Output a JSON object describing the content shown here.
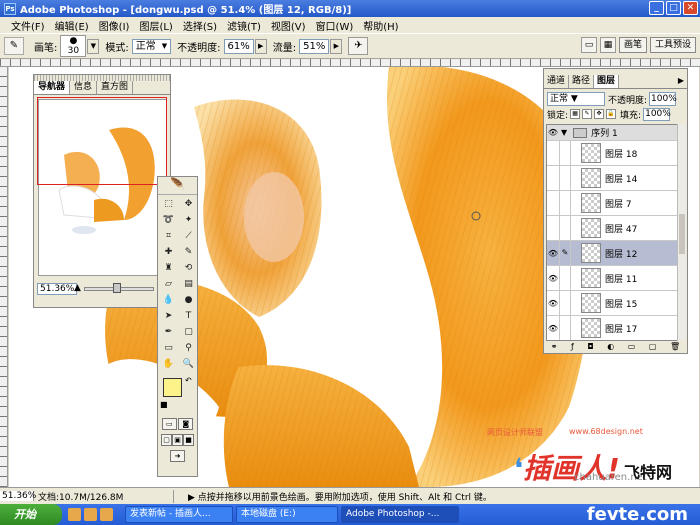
{
  "window": {
    "app_name": "Adobe Photoshop",
    "title": "Adobe Photoshop - [dongwu.psd @ 51.4% (图层 12, RGB/8)]"
  },
  "menu": [
    "文件(F)",
    "编辑(E)",
    "图像(I)",
    "图层(L)",
    "选择(S)",
    "滤镜(T)",
    "视图(V)",
    "窗口(W)",
    "帮助(H)"
  ],
  "options": {
    "brush_label": "画笔:",
    "brush_size": "30",
    "mode_label": "模式:",
    "mode_value": "正常",
    "opacity_label": "不透明度:",
    "opacity_value": "61%",
    "flow_label": "流量:",
    "flow_value": "51%",
    "palette_tab1": "画笔",
    "palette_tab2": "工具预设"
  },
  "navigator": {
    "tabs": [
      "导航器",
      "信息",
      "直方图"
    ],
    "zoom": "51.36%"
  },
  "layers_panel": {
    "tabs": [
      "通道",
      "路径",
      "图层"
    ],
    "blend_mode": "正常",
    "opacity_label": "不透明度:",
    "opacity": "100%",
    "lock_label": "锁定:",
    "fill_label": "填充:",
    "fill": "100%",
    "group_name": "序列 1",
    "layers": [
      {
        "name": "图层 18",
        "visible": false,
        "selected": false
      },
      {
        "name": "图层 14",
        "visible": false,
        "selected": false
      },
      {
        "name": "图层 7",
        "visible": false,
        "selected": false
      },
      {
        "name": "图层 47",
        "visible": false,
        "selected": false
      },
      {
        "name": "图层 12",
        "visible": true,
        "selected": true
      },
      {
        "name": "图层 11",
        "visible": true,
        "selected": false
      },
      {
        "name": "图层 15",
        "visible": true,
        "selected": false
      },
      {
        "name": "图层 17",
        "visible": true,
        "selected": false
      }
    ]
  },
  "status": {
    "zoom": "51.36%",
    "doc": "文档:10.7M/126.8M",
    "message": "点按并拖移以用前景色绘画。要用附加选项，使用 Shift、Alt 和 Ctrl 键。"
  },
  "taskbar": {
    "start": "开始",
    "tasks": [
      "发表新帖 - 插画人...",
      "本地磁盘 (E:)",
      "Adobe Photoshop -..."
    ]
  },
  "watermark": {
    "site1": "网页设计师联盟",
    "site2": "www.68design.net",
    "brand": "插画人!",
    "site3": "chahuaren.net",
    "site4": "飞特网",
    "site5": "fevte.com"
  },
  "colors": {
    "foreground": "#fcf28a",
    "background": "#ffffff",
    "fur_orange": "#f29a1f",
    "fur_light": "#ffd88a"
  }
}
